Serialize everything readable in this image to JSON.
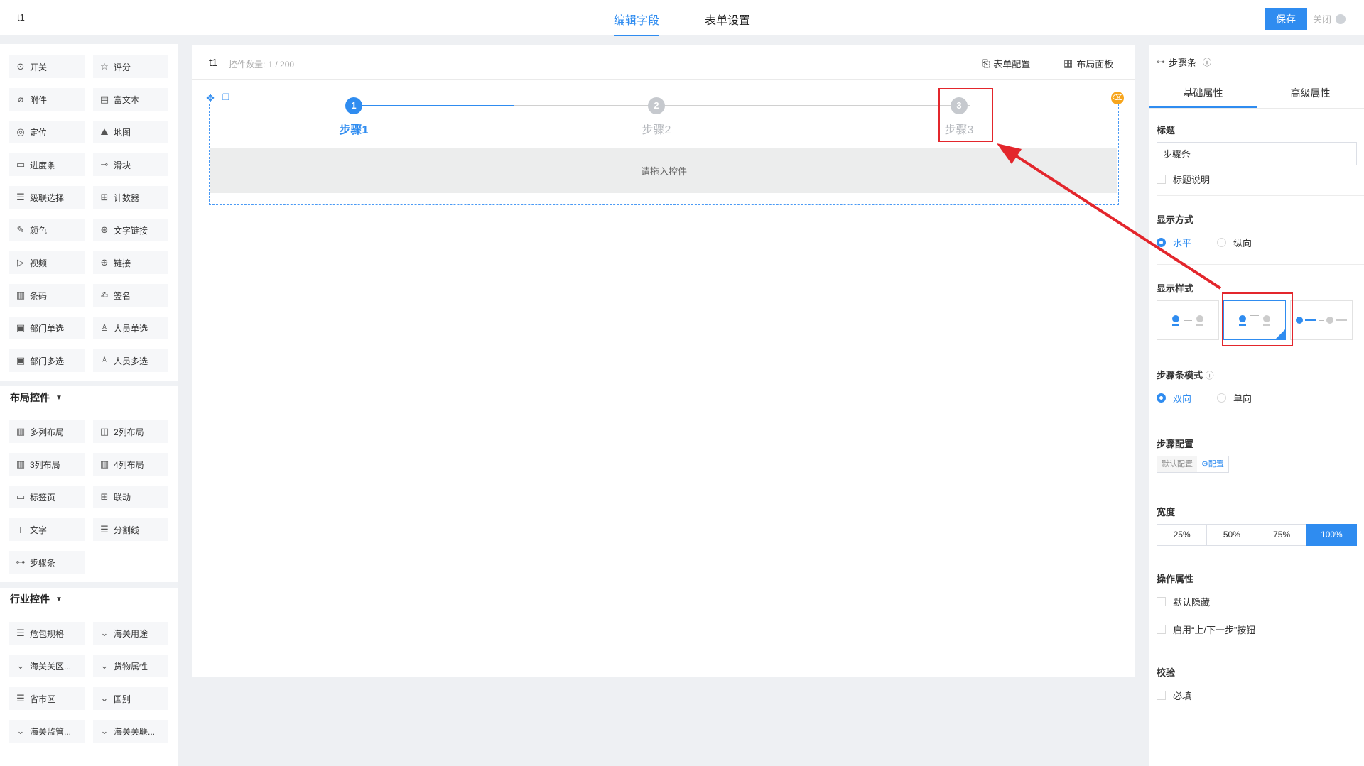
{
  "header": {
    "app_title": "t1",
    "tabs": [
      {
        "label": "编辑字段"
      },
      {
        "label": "表单设置"
      }
    ],
    "save_label": "保存",
    "close_label": "关闭"
  },
  "sidebar": {
    "basic_items": [
      {
        "label": "开关",
        "icon": "toggle-icon",
        "glyph": "⊙"
      },
      {
        "label": "评分",
        "icon": "star-icon",
        "glyph": "☆"
      },
      {
        "label": "附件",
        "icon": "paperclip-icon",
        "glyph": "⌀"
      },
      {
        "label": "富文本",
        "icon": "rich-text-icon",
        "glyph": "▤"
      },
      {
        "label": "定位",
        "icon": "location-icon",
        "glyph": "◎"
      },
      {
        "label": "地图",
        "icon": "map-icon",
        "glyph": "⛰"
      },
      {
        "label": "进度条",
        "icon": "progress-icon",
        "glyph": "▭"
      },
      {
        "label": "滑块",
        "icon": "slider-icon",
        "glyph": "⊸"
      },
      {
        "label": "级联选择",
        "icon": "cascade-icon",
        "glyph": "☰"
      },
      {
        "label": "计数器",
        "icon": "counter-icon",
        "glyph": "⊞"
      },
      {
        "label": "颜色",
        "icon": "color-picker-icon",
        "glyph": "✎"
      },
      {
        "label": "文字链接",
        "icon": "globe-icon",
        "glyph": "⊕"
      },
      {
        "label": "视频",
        "icon": "video-icon",
        "glyph": "▷"
      },
      {
        "label": "链接",
        "icon": "link-globe-icon",
        "glyph": "⊕"
      },
      {
        "label": "条码",
        "icon": "barcode-icon",
        "glyph": "▥"
      },
      {
        "label": "签名",
        "icon": "signature-icon",
        "glyph": "✍"
      },
      {
        "label": "部门单选",
        "icon": "dept-single-icon",
        "glyph": "▣"
      },
      {
        "label": "人员单选",
        "icon": "user-icon",
        "glyph": "♙"
      },
      {
        "label": "部门多选",
        "icon": "dept-multi-icon",
        "glyph": "▣"
      },
      {
        "label": "人员多选",
        "icon": "users-icon",
        "glyph": "♙"
      }
    ],
    "layout_section": "布局控件",
    "layout_items": [
      {
        "label": "多列布局",
        "icon": "multi-column-icon",
        "glyph": "▥"
      },
      {
        "label": "2列布局",
        "icon": "two-column-icon",
        "glyph": "◫"
      },
      {
        "label": "3列布局",
        "icon": "three-column-icon",
        "glyph": "▥"
      },
      {
        "label": "4列布局",
        "icon": "four-column-icon",
        "glyph": "▥"
      },
      {
        "label": "标签页",
        "icon": "tabs-icon",
        "glyph": "▭"
      },
      {
        "label": "联动",
        "icon": "linkage-icon",
        "glyph": "⊞"
      },
      {
        "label": "文字",
        "icon": "text-icon",
        "glyph": "T"
      },
      {
        "label": "分割线",
        "icon": "divider-icon",
        "glyph": "☰"
      },
      {
        "label": "步骤条",
        "icon": "steps-icon",
        "glyph": "⊶"
      }
    ],
    "industry_section": "行业控件",
    "industry_items": [
      {
        "label": "危包规格",
        "icon": "list-icon",
        "glyph": "☰"
      },
      {
        "label": "海关用途",
        "icon": "chevron-down-icon",
        "glyph": "⌄"
      },
      {
        "label": "海关关区...",
        "icon": "chevron-down-icon",
        "glyph": "⌄"
      },
      {
        "label": "货物属性",
        "icon": "chevron-down-icon",
        "glyph": "⌄"
      },
      {
        "label": "省市区",
        "icon": "list-icon",
        "glyph": "☰"
      },
      {
        "label": "国别",
        "icon": "chevron-down-icon",
        "glyph": "⌄"
      },
      {
        "label": "海关监管...",
        "icon": "chevron-down-icon",
        "glyph": "⌄"
      },
      {
        "label": "海关关联...",
        "icon": "chevron-down-icon",
        "glyph": "⌄"
      }
    ]
  },
  "canvas": {
    "title": "t1",
    "count_label": "控件数量:",
    "count_value": "1 / 200",
    "form_config": "表单配置",
    "layout_panel": "布局面板",
    "steps": [
      {
        "number": "1",
        "label": "步骤1",
        "state": "active"
      },
      {
        "number": "2",
        "label": "步骤2",
        "state": "inactive"
      },
      {
        "number": "3",
        "label": "步骤3",
        "state": "inactive"
      }
    ],
    "progress_fraction": 0.25,
    "drop_hint": "请拖入控件"
  },
  "panel": {
    "title": "步骤条",
    "tabs": [
      {
        "label": "基础属性"
      },
      {
        "label": "高级属性"
      }
    ],
    "title_field": {
      "label": "标题",
      "value": "步骤条",
      "desc_checkbox": "标题说明"
    },
    "display_mode": {
      "label": "显示方式",
      "options": [
        "水平",
        "纵向"
      ],
      "selected": "水平"
    },
    "display_style": {
      "label": "显示样式",
      "selected_index": 1
    },
    "steps_mode": {
      "label": "步骤条模式",
      "options": [
        "双向",
        "单向"
      ],
      "selected": "双向"
    },
    "steps_config": {
      "label": "步骤配置",
      "options": [
        "默认配置",
        "配置"
      ],
      "selected": "配置"
    },
    "width": {
      "label": "宽度",
      "options": [
        "25%",
        "50%",
        "75%",
        "100%"
      ],
      "selected": "100%"
    },
    "operation": {
      "label": "操作属性",
      "hide_default": "默认隐藏",
      "enable_nav": "启用“上/下一步”按钮"
    },
    "validation": {
      "label": "校验",
      "required": "必填"
    }
  },
  "colors": {
    "accent": "#2f8cf0",
    "annotation": "#e3262c",
    "warning": "#f7a51c"
  }
}
